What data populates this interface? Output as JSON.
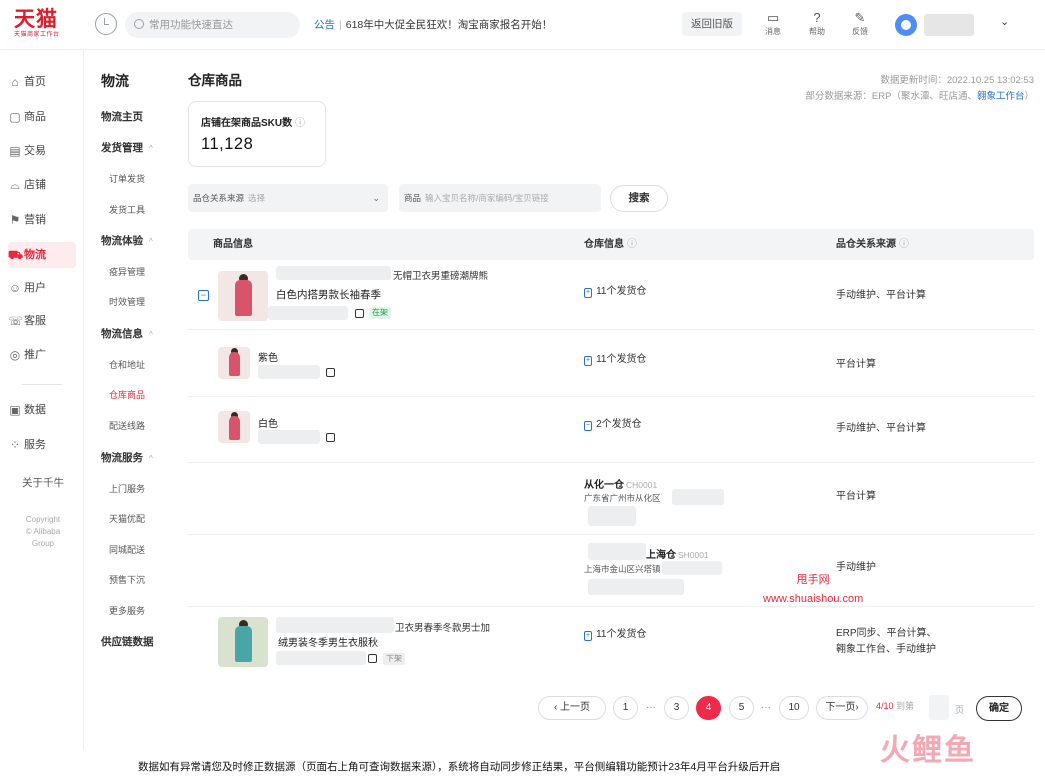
{
  "brand": {
    "logo_text": "天猫",
    "logo_sub": "天猫商家工作台"
  },
  "topbar": {
    "search_placeholder": "常用功能快速直达",
    "notice_tag": "公告",
    "notice_text": "618年中大促全民狂欢！淘宝商家报名开始！",
    "old_version": "返回旧版",
    "tools": [
      {
        "label": "消息",
        "icon": "message-icon"
      },
      {
        "label": "帮助",
        "icon": "help-icon"
      },
      {
        "label": "反馈",
        "icon": "feedback-icon"
      }
    ]
  },
  "leftnav": {
    "items": [
      {
        "label": "首页",
        "icon": "⌂"
      },
      {
        "label": "商品",
        "icon": "▢"
      },
      {
        "label": "交易",
        "icon": "▤"
      },
      {
        "label": "店铺",
        "icon": "⌓"
      },
      {
        "label": "营销",
        "icon": "⚑"
      },
      {
        "label": "物流",
        "icon": "⛟"
      },
      {
        "label": "用户",
        "icon": "☺"
      },
      {
        "label": "客服",
        "icon": "☏"
      },
      {
        "label": "推广",
        "icon": "◎"
      },
      {
        "label": "数据",
        "icon": "▣"
      },
      {
        "label": "服务",
        "icon": "⁘"
      }
    ],
    "about": "关于千牛",
    "copyright": [
      "Copyright",
      "© Alibaba",
      "Group"
    ]
  },
  "subnav": {
    "title": "物流",
    "items": [
      {
        "label": "物流主页",
        "type": "group"
      },
      {
        "label": "发货管理",
        "type": "group",
        "chev": "^"
      },
      {
        "label": "订单发货",
        "type": "child"
      },
      {
        "label": "发货工具",
        "type": "child"
      },
      {
        "label": "物流体验",
        "type": "group",
        "chev": "^"
      },
      {
        "label": "疫异管理",
        "type": "child"
      },
      {
        "label": "时效管理",
        "type": "child"
      },
      {
        "label": "物流信息",
        "type": "group",
        "chev": "^"
      },
      {
        "label": "仓和地址",
        "type": "child"
      },
      {
        "label": "仓库商品",
        "type": "child",
        "active": true
      },
      {
        "label": "配送线路",
        "type": "child"
      },
      {
        "label": "物流服务",
        "type": "group",
        "chev": "^"
      },
      {
        "label": "上门服务",
        "type": "child"
      },
      {
        "label": "天猫优配",
        "type": "child"
      },
      {
        "label": "同城配送",
        "type": "child"
      },
      {
        "label": "预售下沉",
        "type": "child"
      },
      {
        "label": "更多服务",
        "type": "child"
      },
      {
        "label": "供应链数据",
        "type": "group"
      }
    ]
  },
  "main": {
    "title": "仓库商品",
    "update_time": "数据更新时间：2022.10.25 13:02:53",
    "source_prefix": "部分数据来源：ERP（聚水潭、旺店通、",
    "source_link": "翱象工作台",
    "source_suffix": "）",
    "sku_label": "店铺在架商品SKU数",
    "sku_value": "11,128",
    "filter_source_label": "品仓关系来源",
    "filter_source_placeholder": "选择",
    "filter_product_label": "商品",
    "filter_product_placeholder": "输入宝贝名称/商家编码/宝贝链接",
    "search_button": "搜索",
    "columns": [
      "商品信息",
      "仓库信息",
      "品仓关系来源"
    ]
  },
  "rows": {
    "r1": {
      "title": "无帽卫衣男重磅潮牌熊",
      "name": "白色内搭男款长袖春季",
      "badge": "在架",
      "warehouse": "11个发货仓",
      "source": "手动维护、平台计算"
    },
    "r2": {
      "name": "紫色",
      "warehouse": "11个发货仓",
      "source": "平台计算"
    },
    "r3": {
      "name": "白色",
      "warehouse": "2个发货仓",
      "source": "手动维护、平台计算"
    },
    "r4": {
      "wh_name": "从化一仓",
      "wh_code": "CH0001",
      "wh_addr": "广东省广州市从化区",
      "source": "平台计算"
    },
    "r5": {
      "wh_name": "上海仓",
      "wh_code": "SH0001",
      "wh_addr": "上海市金山区兴塔镇",
      "source": "手动维护"
    },
    "r6": {
      "title": "卫衣男春季冬款男士加",
      "name": "绒男装冬季男生衣服秋",
      "badge": "下架",
      "warehouse": "11个发货仓",
      "source_line1": "ERP同步、平台计算、",
      "source_line2": "翱象工作台、手动维护"
    }
  },
  "watermark": {
    "line1": "甩手网",
    "line2": "www.shuaishou.com"
  },
  "pager": {
    "prev": "‹ 上一页",
    "next": "下一页›",
    "pages": [
      "1",
      "3",
      "4",
      "5",
      "10"
    ],
    "current": "4",
    "dots": "···",
    "info_current": "4/10",
    "info_goto": "到第",
    "unit": "页",
    "ok": "确定"
  },
  "caption": "数据如有异常请您及时修正数据源（页面右上角可查询数据来源），系统将自动同步修正结果，平台侧编辑功能预计23年4月平台升级后开启",
  "watermark_brand": "火鲤鱼",
  "colors": {
    "accent": "#e8283d",
    "link": "#2a6fd6",
    "current_page": "#ee2b4b"
  }
}
